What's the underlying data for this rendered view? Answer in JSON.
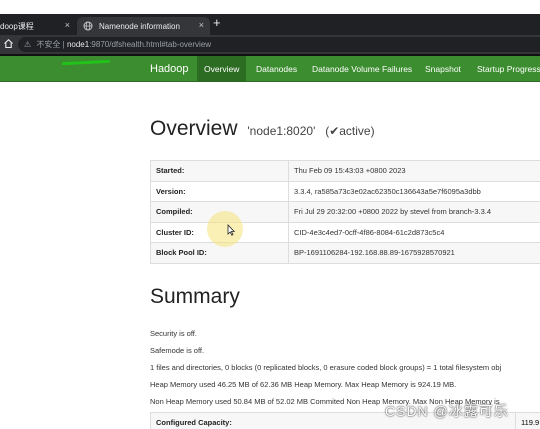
{
  "browser": {
    "tabs": [
      {
        "label": "doop课程"
      },
      {
        "label": "Namenode information"
      }
    ],
    "new_tab": "+",
    "tab_close": "×",
    "address": {
      "security": "不安全",
      "host": "node1",
      "port_path": ":9870/dfshealth.html#tab-overview"
    }
  },
  "navbar": {
    "brand": "Hadoop",
    "items": [
      {
        "label": "Overview"
      },
      {
        "label": "Datanodes"
      },
      {
        "label": "Datanode Volume Failures"
      },
      {
        "label": "Snapshot"
      },
      {
        "label": "Startup Progress"
      }
    ]
  },
  "overview": {
    "title": "Overview",
    "node": "'node1:8020'",
    "status": "(✔active)",
    "rows": [
      {
        "key": "Started:",
        "value": "Thu Feb 09 15:43:03 +0800 2023"
      },
      {
        "key": "Version:",
        "value": "3.3.4, ra585a73c3e02ac62350c136643a5e7f6095a3dbb"
      },
      {
        "key": "Compiled:",
        "value": "Fri Jul 29 20:32:00 +0800 2022 by stevel from branch-3.3.4"
      },
      {
        "key": "Cluster ID:",
        "value": "CID-4e3c4ed7-0cff-4f86-8084-61c2d873c5c4"
      },
      {
        "key": "Block Pool ID:",
        "value": "BP-1691106284-192.168.88.89-1675928570921"
      }
    ]
  },
  "summary": {
    "title": "Summary",
    "lines": [
      "Security is off.",
      "Safemode is off.",
      "1 files and directories, 0 blocks (0 replicated blocks, 0 erasure coded block groups) = 1 total filesystem obj",
      "Heap Memory used 46.25 MB of 62.36 MB Heap Memory. Max Heap Memory is 924.19 MB.",
      "Non Heap Memory used 50.84 MB of 52.02 MB Commited Non Heap Memory. Max Non Heap Memory is"
    ],
    "capacity": {
      "key": "Configured Capacity:",
      "value": "119.9"
    }
  },
  "watermark": "CSDN @冰露可乐"
}
